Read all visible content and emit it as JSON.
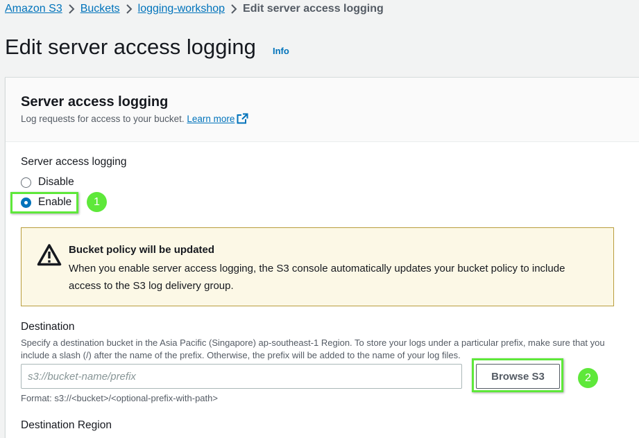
{
  "breadcrumb": {
    "items": [
      "Amazon S3",
      "Buckets",
      "logging-workshop"
    ],
    "current": "Edit server access logging"
  },
  "page": {
    "title": "Edit server access logging",
    "info_label": "Info"
  },
  "panel": {
    "title": "Server access logging",
    "description": "Log requests for access to your bucket.",
    "learn_more": "Learn more"
  },
  "logging": {
    "label": "Server access logging",
    "options": [
      "Disable",
      "Enable"
    ],
    "selected": "Enable"
  },
  "alert": {
    "type": "warning",
    "title": "Bucket policy will be updated",
    "body": "When you enable server access logging, the S3 console automatically updates your bucket policy to include access to the S3 log delivery group."
  },
  "destination": {
    "label": "Destination",
    "description": "Specify a destination bucket in the Asia Pacific (Singapore) ap-southeast-1 Region. To store your logs under a particular prefix, make sure that you include a slash (/) after the name of the prefix. Otherwise, the prefix will be added to the name of your log files.",
    "placeholder": "s3://bucket-name/prefix",
    "value": "",
    "browse_label": "Browse S3",
    "format_hint": "Format: s3://<bucket>/<optional-prefix-with-path>"
  },
  "destination_region": {
    "label": "Destination Region"
  },
  "annotations": {
    "step1": "1",
    "step2": "2"
  },
  "colors": {
    "link": "#0073bb",
    "highlight": "#5ee83a",
    "warning_bg": "#fcf8e6",
    "warning_border": "#b99d3c"
  }
}
